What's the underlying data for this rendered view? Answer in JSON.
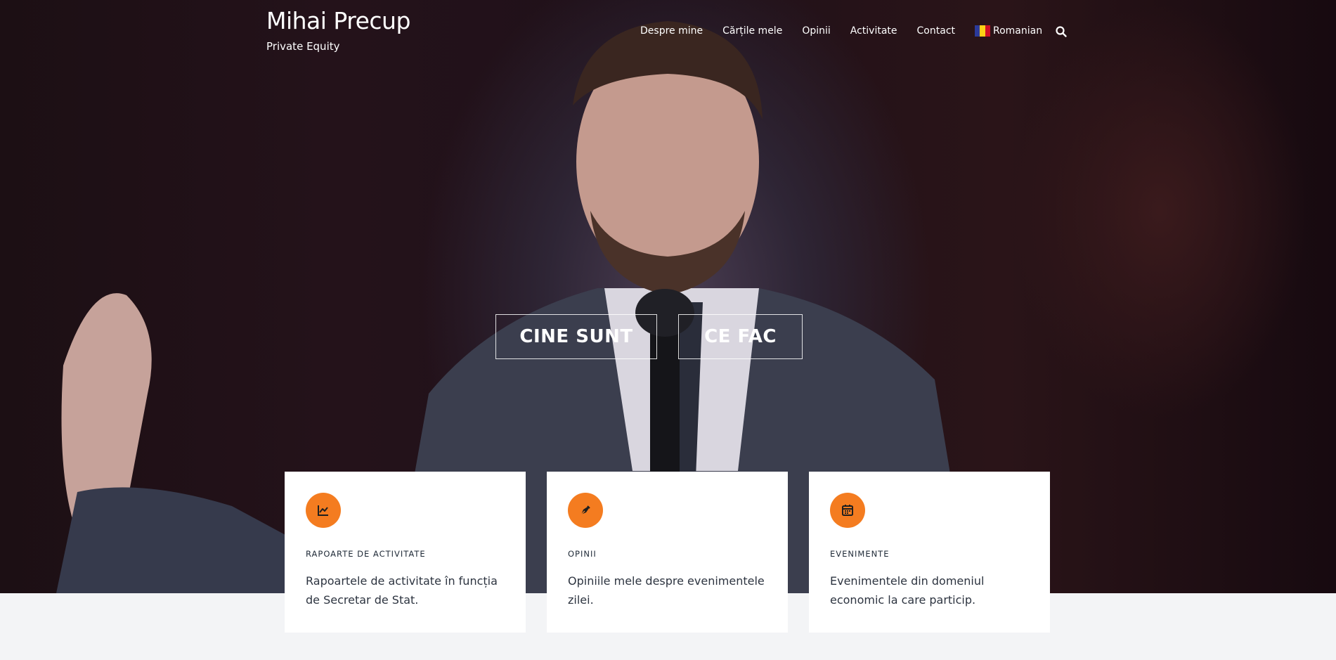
{
  "site": {
    "title": "Mihai Precup",
    "tagline": "Private Equity"
  },
  "nav": {
    "items": [
      {
        "label": "Despre mine"
      },
      {
        "label": "Cărțile mele"
      },
      {
        "label": "Opinii"
      },
      {
        "label": "Activitate"
      },
      {
        "label": "Contact"
      }
    ],
    "language": {
      "label": "Romanian",
      "flag_colors": [
        "#2b3a9a",
        "#fcd116",
        "#ce1126"
      ]
    },
    "search_icon": "search-icon"
  },
  "hero": {
    "buttons": [
      {
        "label": "CINE SUNT"
      },
      {
        "label": "CE FAC"
      }
    ]
  },
  "cards": [
    {
      "icon": "chart-line-icon",
      "heading": "RAPOARTE DE ACTIVITATE",
      "text": "Rapoartele de activitate în funcția de Secretar de Stat."
    },
    {
      "icon": "pen-nib-icon",
      "heading": "OPINII",
      "text": "Opiniile mele despre evenimentele zilei."
    },
    {
      "icon": "calendar-icon",
      "heading": "EVENIMENTE",
      "text": "Evenimentele din domeniul economic la care particip."
    }
  ],
  "colors": {
    "accent": "#f47c20",
    "hero_dark": "#1c0f14",
    "page_bg": "#f3f4f6"
  }
}
